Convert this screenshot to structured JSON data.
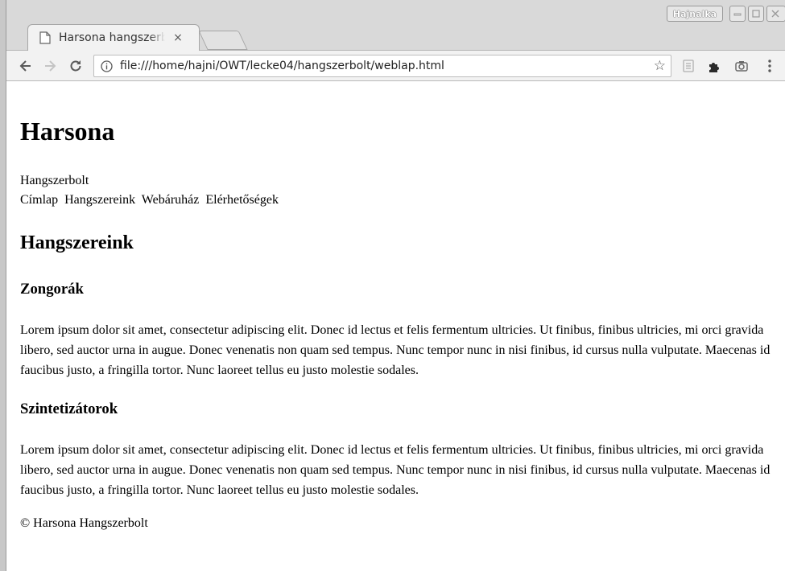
{
  "browser": {
    "tab": {
      "title": "Harsona hangszerbolt",
      "close": "×"
    },
    "profile": "Hajnalka",
    "address": {
      "url": "file:///home/hajni/OWT/lecke04/hangszerbolt/weblap.html"
    },
    "icons": {
      "back": "arrow-left-icon",
      "forward": "arrow-right-icon",
      "reload": "reload-icon",
      "info": "info-icon",
      "star": "star-icon",
      "reader": "reader-mode-icon",
      "extension": "puzzle-piece-icon",
      "camera": "camera-icon",
      "menu": "kebab-menu-icon"
    }
  },
  "page": {
    "title": "Harsona",
    "subtitle": "Hangszerbolt",
    "nav": [
      "Címlap",
      "Hangszereink",
      "Webáruház",
      "Elérhetőségek"
    ],
    "section_title": "Hangszereink",
    "sections": [
      {
        "heading": "Zongorák",
        "text": "Lorem ipsum dolor sit amet, consectetur adipiscing elit. Donec id lectus et felis fermentum ultricies. Ut finibus, finibus ultricies, mi orci gravida libero, sed auctor urna in augue. Donec venenatis non quam sed tempus. Nunc tempor nunc in nisi finibus, id cursus nulla vulputate. Maecenas id faucibus justo, a fringilla tortor. Nunc laoreet tellus eu justo molestie sodales."
      },
      {
        "heading": "Szintetizátorok",
        "text": "Lorem ipsum dolor sit amet, consectetur adipiscing elit. Donec id lectus et felis fermentum ultricies. Ut finibus, finibus ultricies, mi orci gravida libero, sed auctor urna in augue. Donec venenatis non quam sed tempus. Nunc tempor nunc in nisi finibus, id cursus nulla vulputate. Maecenas id faucibus justo, a fringilla tortor. Nunc laoreet tellus eu justo molestie sodales."
      }
    ],
    "footer": "© Harsona Hangszerbolt"
  }
}
